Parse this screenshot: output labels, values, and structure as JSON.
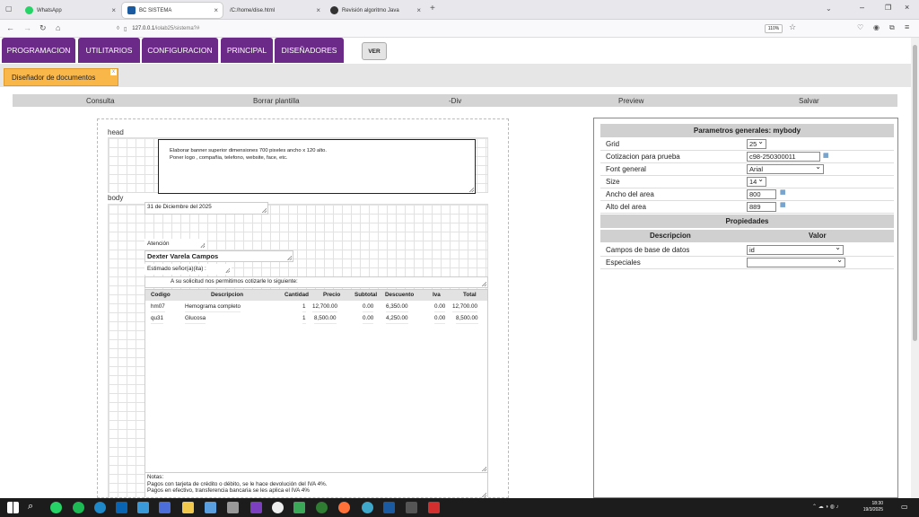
{
  "browser": {
    "tabs": [
      {
        "title": "WhatsApp",
        "icon": "whatsapp-icon",
        "color": "#25d366"
      },
      {
        "title": "BC SISTEMA",
        "icon": "io-icon",
        "color": "#1a5aa0"
      },
      {
        "title": "/C:/home/dise.html",
        "icon": "file-icon",
        "color": "#888888"
      },
      {
        "title": "Revisión algoritmo Java",
        "icon": "chatgpt-icon",
        "color": "#333333"
      }
    ],
    "url_host": "127.0.0.1",
    "url_path": "/iolab25/sistema?#",
    "zoom": "110%"
  },
  "menu": {
    "items": [
      "PROGRAMACION",
      "UTILITARIOS",
      "CONFIGURACION",
      "PRINCIPAL",
      "DISEÑADORES"
    ],
    "ver": "VER",
    "accent": "#6b2a87"
  },
  "doc_tab": {
    "label": "Diseñador de documentos",
    "close": "x",
    "color": "#f9b74a"
  },
  "actions": [
    "Consulta",
    "Borrar plantilla",
    "-Div",
    "Preview",
    "Salvar"
  ],
  "designer": {
    "head_label": "head",
    "body_label": "body",
    "banner_lines": [
      "Elaborar banner superior dimensiones 700 pixeles ancho x 120 alto.",
      "Poner logo , compañia, telefono, website, face, etc."
    ],
    "date": "31 de Diciembre del 2025",
    "atencion": "Atención",
    "client": "Dexter Varela Campos",
    "greeting": "Estimado señor(a)(ita) :",
    "intro": "A su solicitud nos permitimos cotizarle lo siguiente:",
    "table": {
      "headers": [
        "Codigo",
        "Descripcion",
        "Cantidad",
        "Precio",
        "Subtotal",
        "Descuento",
        "Iva",
        "Total"
      ],
      "rows": [
        [
          "hm07",
          "Hemograma completo",
          "1",
          "12,700.00",
          "0.00",
          "6,350.00",
          "0.00",
          "12,700.00"
        ],
        [
          "qu31",
          "Glucosa",
          "1",
          "8,500.00",
          "0.00",
          "4,250.00",
          "0.00",
          "8,500.00"
        ]
      ]
    },
    "notes": [
      "Notas:",
      "Pagos con tarjeta de crédito o débito, se le hace devolución del IVA 4%.",
      "Pagos en efectivo, transferencia bancaria se les aplica el IVA 4%"
    ]
  },
  "panel": {
    "title": "Parametros generales: mybody",
    "params": [
      {
        "label": "Grid",
        "value": "25"
      },
      {
        "label": "Cotizacion para prueba",
        "value": "c98-250300011"
      },
      {
        "label": "Font general",
        "value": "Arial"
      },
      {
        "label": "Size",
        "value": "14"
      },
      {
        "label": "Ancho del area",
        "value": "800"
      },
      {
        "label": "Alto del area",
        "value": "889"
      }
    ],
    "props_title": "Propiedades",
    "props_headers": [
      "Descripcion",
      "Valor"
    ],
    "props": [
      {
        "label": "Campos de base de datos",
        "value": "id"
      },
      {
        "label": "Especiales",
        "value": ""
      }
    ]
  },
  "taskbar": {
    "time": "18:30",
    "date": "19/3/2025"
  }
}
